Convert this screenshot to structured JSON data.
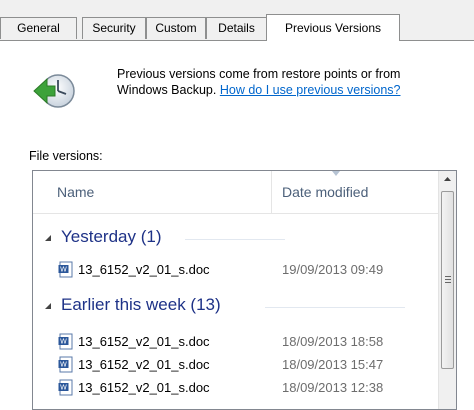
{
  "tabs": [
    {
      "label": "General",
      "active": false
    },
    {
      "label": "Security",
      "active": false
    },
    {
      "label": "Custom",
      "active": false
    },
    {
      "label": "Details",
      "active": false
    },
    {
      "label": "Previous Versions",
      "active": true
    }
  ],
  "info": {
    "line1": "Previous versions come from restore points or from",
    "line2_prefix": "Windows Backup.",
    "help_link": "How do I use previous versions?",
    "icon": "restore-clock-icon"
  },
  "file_versions_label": "File versions:",
  "list": {
    "columns": {
      "name": "Name",
      "date": "Date modified"
    },
    "groups": [
      {
        "label": "Yesterday (1)",
        "rows": [
          {
            "name": "13_6152_v2_01_s.doc",
            "date": "19/09/2013 09:49"
          }
        ]
      },
      {
        "label": "Earlier this week (13)",
        "rows": [
          {
            "name": "13_6152_v2_01_s.doc",
            "date": "18/09/2013 18:58"
          },
          {
            "name": "13_6152_v2_01_s.doc",
            "date": "18/09/2013 15:47"
          },
          {
            "name": "13_6152_v2_01_s.doc",
            "date": "18/09/2013 12:38"
          }
        ]
      }
    ]
  },
  "colors": {
    "group_text": "#1e3287",
    "link": "#0066cc",
    "header_text": "#4c607a",
    "date_text": "#6d6d6d"
  }
}
